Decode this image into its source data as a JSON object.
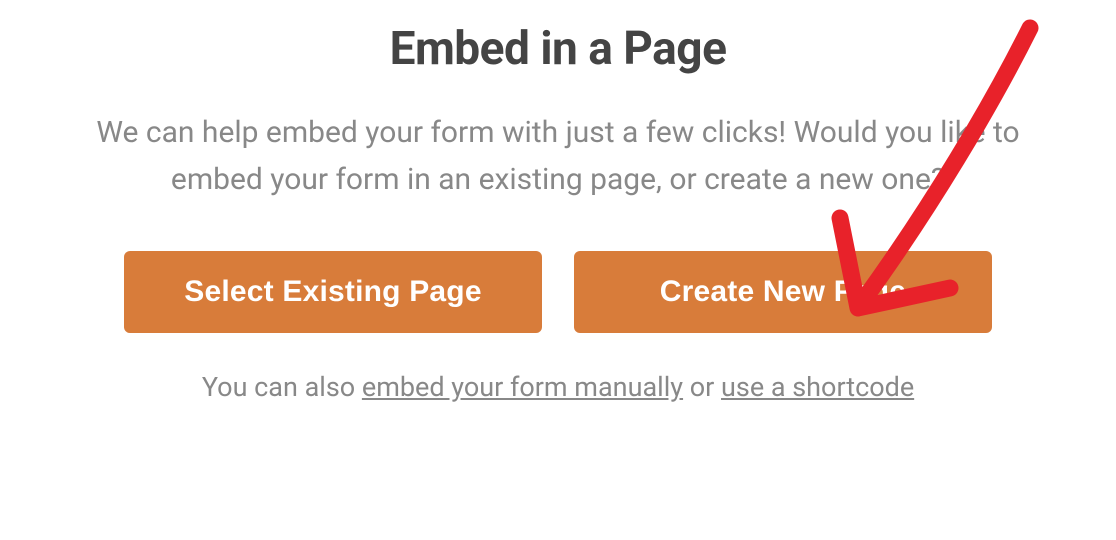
{
  "title": "Embed in a Page",
  "description": "We can help embed your form with just a few clicks! Would you like to embed your form in an existing page, or create a new one?",
  "buttons": {
    "select_existing": "Select Existing Page",
    "create_new": "Create New Page"
  },
  "footer": {
    "prefix": "You can also ",
    "link1": "embed your form manually",
    "middle": " or ",
    "link2": "use a shortcode"
  },
  "colors": {
    "button_bg": "#d87c3a",
    "title_color": "#444444",
    "text_color": "#888888",
    "annotation_color": "#e8222a"
  }
}
